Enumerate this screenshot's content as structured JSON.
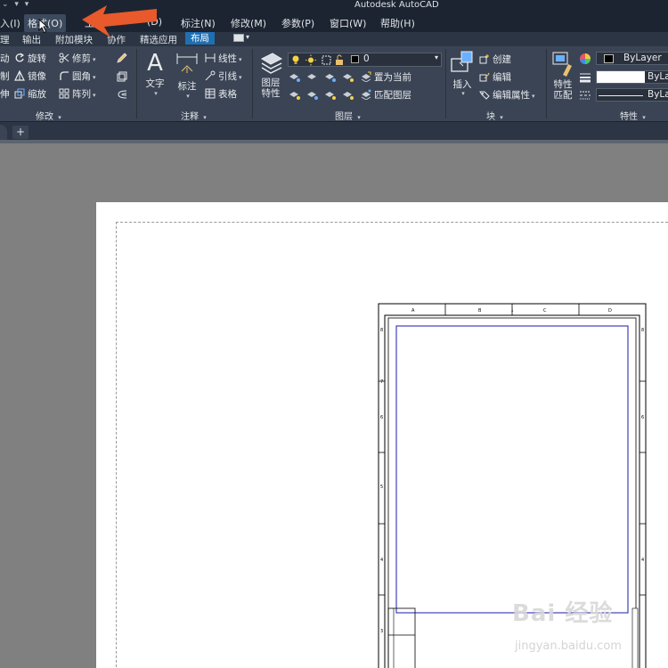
{
  "app": {
    "title": "Autodesk AutoCAD"
  },
  "quick_access": "⌄ ▾ ▾",
  "menu": [
    {
      "label": "入(I)",
      "name": "menu-insert"
    },
    {
      "label": "格式(O)",
      "name": "menu-format"
    },
    {
      "label": "工",
      "name": "menu-tools"
    },
    {
      "label": "(D)",
      "name": "menu-draw"
    },
    {
      "label": "标注(N)",
      "name": "menu-dimension"
    },
    {
      "label": "修改(M)",
      "name": "menu-modify"
    },
    {
      "label": "参数(P)",
      "name": "menu-parametric"
    },
    {
      "label": "窗口(W)",
      "name": "menu-window"
    },
    {
      "label": "帮助(H)",
      "name": "menu-help"
    }
  ],
  "ribbon_tabs": [
    {
      "label": "理"
    },
    {
      "label": "输出"
    },
    {
      "label": "附加模块"
    },
    {
      "label": "协作"
    },
    {
      "label": "精选应用"
    },
    {
      "label": "布局"
    }
  ],
  "modify_panel": {
    "title": "修改",
    "rotate": "旋转",
    "trim": "修剪",
    "mirror": "镜像",
    "fillet": "圆角",
    "scale": "缩放",
    "array": "阵列",
    "left_col": [
      "动",
      "制",
      "伸"
    ]
  },
  "annotation_panel": {
    "title": "注释",
    "text": "文字",
    "dimension": "标注",
    "linear": "线性",
    "leader": "引线",
    "table": "表格"
  },
  "layers_panel": {
    "title": "图层",
    "layer_properties_line1": "图层",
    "layer_properties_line2": "特性",
    "current_layer": "0",
    "set_current": "置为当前",
    "match_layer": "匹配图层"
  },
  "block_panel": {
    "title": "块",
    "insert": "插入",
    "create": "创建",
    "edit": "编辑",
    "edit_attributes": "编辑属性"
  },
  "properties_panel": {
    "title": "特性",
    "match_line1": "特性",
    "match_line2": "匹配",
    "color": "ByLayer",
    "linetype": "ByLay",
    "lineweight": "ByLay"
  },
  "tabs": {
    "new_tab": "+"
  },
  "watermark": {
    "main": "Bai 经验",
    "sub": "jingyan.baidu.com"
  },
  "colors": {
    "accent_arrow": "#e8592b",
    "active_tab": "#1f6fb3",
    "viewport_border": "#3f3fbf"
  }
}
